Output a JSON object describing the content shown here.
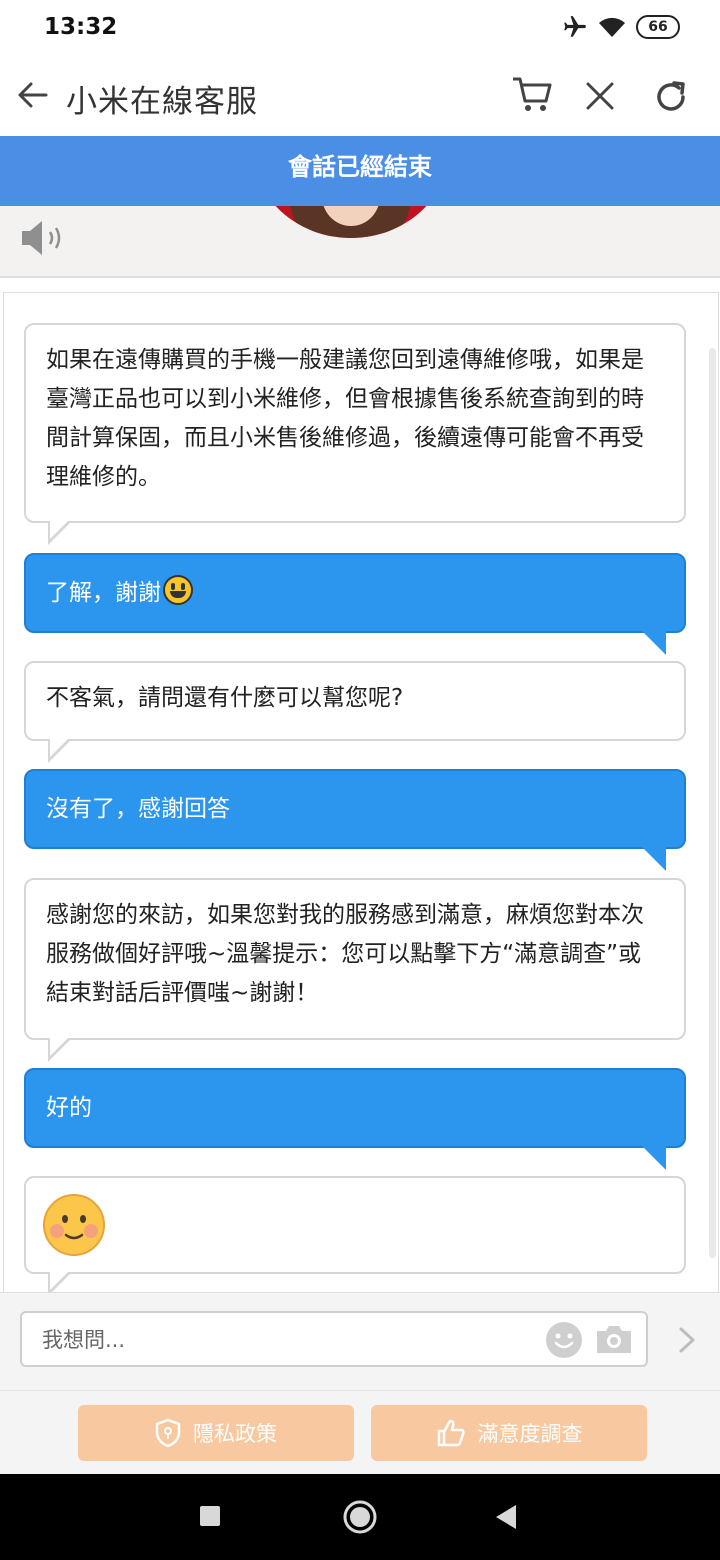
{
  "status_bar": {
    "time": "13:32",
    "battery": "66"
  },
  "header": {
    "title": "小米在線客服"
  },
  "banner": {
    "text": "會話已經結束"
  },
  "messages": [
    {
      "from": "agent",
      "text": "如果在遠傳購買的手機一般建議您回到遠傳維修哦，如果是臺灣正品也可以到小米維修，但會根據售後系統查詢到的時間計算保固，而且小米售後維修過，後續遠傳可能會不再受理維修的。"
    },
    {
      "from": "user",
      "text": "了解，謝謝"
    },
    {
      "from": "agent",
      "text": "不客氣，請問還有什麼可以幫您呢?"
    },
    {
      "from": "user",
      "text": "沒有了，感謝回答"
    },
    {
      "from": "agent",
      "text": "感謝您的來訪，如果您對我的服務感到滿意，麻煩您對本次服務做個好評哦~溫馨提示：您可以點擊下方“滿意調查”或結束對話后評價嗤~謝謝！"
    },
    {
      "from": "user",
      "text": "好的"
    },
    {
      "from": "agent",
      "emoji": "blush-smile-emoji"
    }
  ],
  "input": {
    "placeholder": "我想問..."
  },
  "buttons": {
    "privacy": "隱私政策",
    "survey": "滿意度調查"
  },
  "colors": {
    "banner": "#4a8ee6",
    "user_bubble": "#2c96ee",
    "bottom_buttons": "#f8c9a1"
  }
}
